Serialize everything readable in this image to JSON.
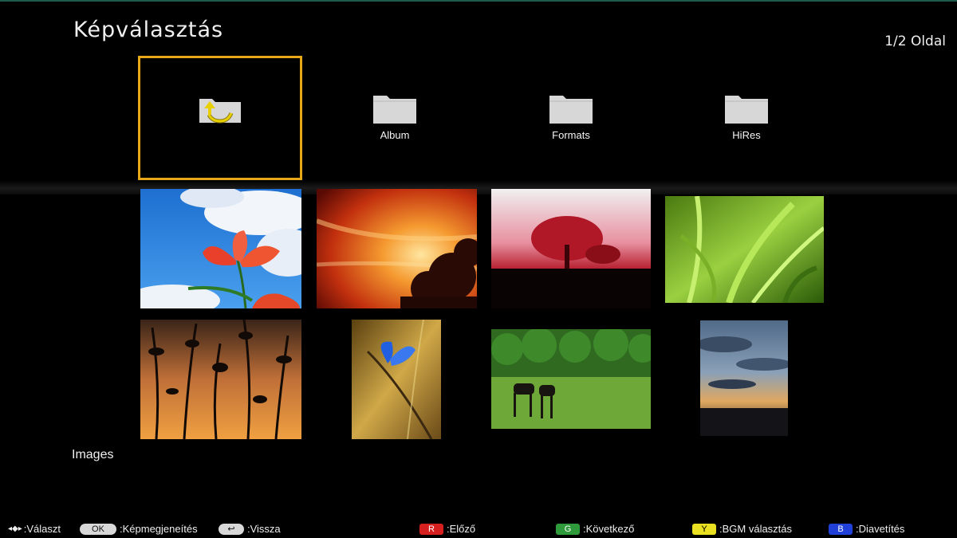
{
  "header": {
    "title": "Képválasztás",
    "page_indicator": "1/2 Oldal"
  },
  "folders": [
    {
      "label": "",
      "icon": "folder-up-icon",
      "selected": true
    },
    {
      "label": "Album",
      "icon": "folder-icon"
    },
    {
      "label": "Formats",
      "icon": "folder-icon"
    },
    {
      "label": "HiRes",
      "icon": "folder-icon"
    }
  ],
  "current_folder_label": "Images",
  "colors": {
    "selection": "#e6a817",
    "folder": "#d7d7d7",
    "red_key": "#d62020",
    "green_key": "#2e9a3a",
    "yellow_key": "#e8e020",
    "blue_key": "#2040d8"
  },
  "help_bar": {
    "nav_label": ":Választ",
    "ok_key": "OK",
    "ok_label": ":Képmegjeneítés",
    "back_label": ":Vissza",
    "red_key": "R",
    "red_label": ":Előző",
    "green_key": "G",
    "green_label": ":Következő",
    "yellow_key": "Y",
    "yellow_label": ":BGM választás",
    "blue_key": "B",
    "blue_label": ":Diavetítés"
  }
}
